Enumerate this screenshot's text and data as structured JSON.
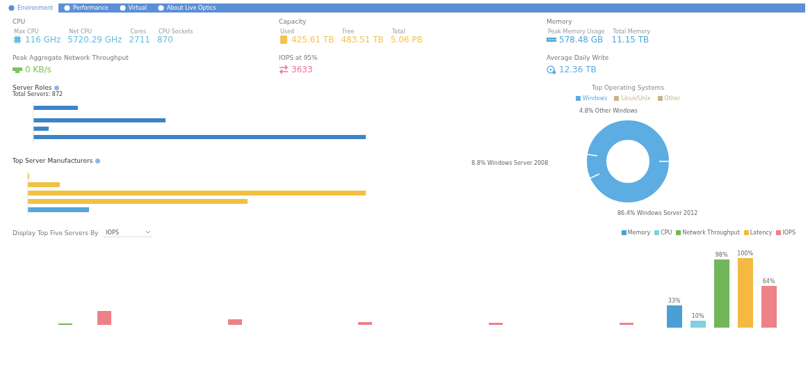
{
  "tabs": [
    {
      "label": "Environment",
      "selected": true
    },
    {
      "label": "Performance",
      "selected": false
    },
    {
      "label": "Virtual",
      "selected": false
    },
    {
      "label": "About Live Optics",
      "selected": false
    }
  ],
  "metrics": [
    {
      "title": "CPU",
      "kind": "cpu",
      "color": "#62bde0",
      "stats": [
        {
          "label": "Max CPU",
          "value": "116 GHz"
        },
        {
          "label": "Net CPU",
          "value": "5720.29 GHz"
        },
        {
          "label": "Cores",
          "value": "2711"
        },
        {
          "label": "CPU Sockets",
          "value": "870"
        }
      ]
    },
    {
      "title": "Capacity",
      "kind": "disk",
      "color": "#f2c350",
      "stats": [
        {
          "label": "Used",
          "value": "425.61 TB"
        },
        {
          "label": "Free",
          "value": "483.51 TB"
        },
        {
          "label": "Total",
          "value": "5.06 PB"
        }
      ]
    },
    {
      "title": "Memory",
      "kind": "memory",
      "color": "#4aa8dc",
      "stats": [
        {
          "label": "Peak Memory Usage",
          "value": "578.48 GB"
        },
        {
          "label": "Total Memory",
          "value": "11.15 TB"
        }
      ]
    },
    {
      "title": "Peak Aggregate Network Throughput",
      "kind": "network",
      "color": "#7cc25a",
      "stats": [
        {
          "value": "0 KB/s"
        }
      ]
    },
    {
      "title": "IOPS at 95%",
      "kind": "iops",
      "color": "#ef6f9c",
      "stats": [
        {
          "value": "3633"
        }
      ]
    },
    {
      "title": "Average Daily Write",
      "kind": "write",
      "color": "#5aaee0",
      "stats": [
        {
          "value": "12.36 TB"
        }
      ]
    }
  ],
  "server_roles": {
    "title": "Server Roles",
    "subtitle": "Total Servers: 872"
  },
  "manufacturers": {
    "title": "Top Server Manufacturers"
  },
  "operating_systems": {
    "title": "Top Operating Systems",
    "legend": [
      {
        "label": "Windows",
        "color": "#5dade2"
      },
      {
        "label": "Linux/Unix",
        "color": "#c9b48a"
      },
      {
        "label": "Other",
        "color": "#c9b48a"
      }
    ],
    "slice_labels": [
      "4.8% Other Windows",
      "8.8% Windows Server 2008",
      "86.4% Windows Server 2012"
    ]
  },
  "top_five": {
    "label": "Display Top Five Servers By",
    "dropdown": {
      "value": "IOPS"
    },
    "legend": [
      {
        "label": "Memory",
        "color": "#4a9fd4"
      },
      {
        "label": "CPU",
        "color": "#7fd0e2"
      },
      {
        "label": "Network Throughput",
        "color": "#72b65a"
      },
      {
        "label": "Latency",
        "color": "#f5b942"
      },
      {
        "label": "IOPS",
        "color": "#ee8088"
      }
    ],
    "bar_labels": [
      "33%",
      "10%",
      "98%",
      "100%",
      "64%"
    ]
  }
}
